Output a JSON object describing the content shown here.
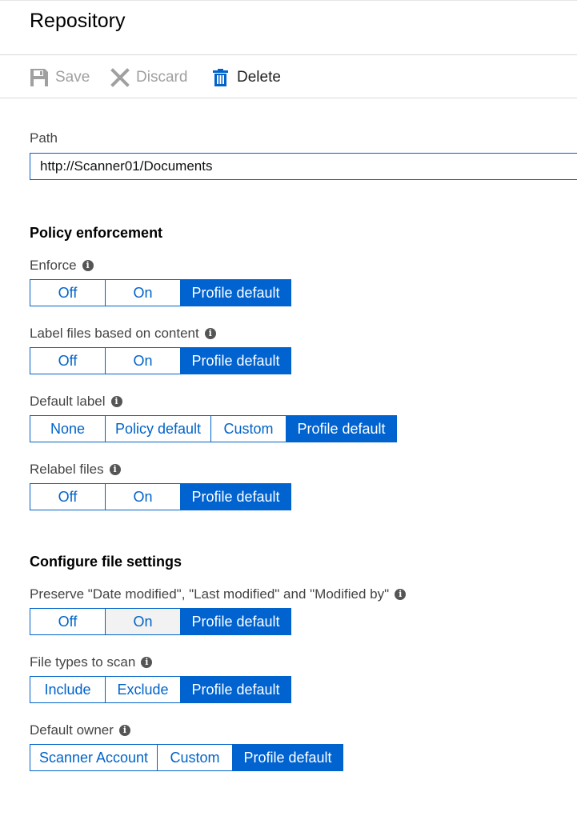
{
  "title": "Repository",
  "toolbar": {
    "save_label": "Save",
    "discard_label": "Discard",
    "delete_label": "Delete"
  },
  "path": {
    "label": "Path",
    "value": "http://Scanner01/Documents"
  },
  "policy_section": {
    "heading": "Policy enforcement",
    "enforce": {
      "label": "Enforce",
      "options": [
        "Off",
        "On",
        "Profile default"
      ],
      "selected": "Profile default"
    },
    "label_files": {
      "label": "Label files based on content",
      "options": [
        "Off",
        "On",
        "Profile default"
      ],
      "selected": "Profile default"
    },
    "default_label": {
      "label": "Default label",
      "options": [
        "None",
        "Policy default",
        "Custom",
        "Profile default"
      ],
      "selected": "Profile default"
    },
    "relabel": {
      "label": "Relabel files",
      "options": [
        "Off",
        "On",
        "Profile default"
      ],
      "selected": "Profile default"
    }
  },
  "file_section": {
    "heading": "Configure file settings",
    "preserve": {
      "label": "Preserve \"Date modified\", \"Last modified\" and \"Modified by\"",
      "options": [
        "Off",
        "On",
        "Profile default"
      ],
      "selected": "Profile default"
    },
    "file_types": {
      "label": "File types to scan",
      "options": [
        "Include",
        "Exclude",
        "Profile default"
      ],
      "selected": "Profile default"
    },
    "default_owner": {
      "label": "Default owner",
      "options": [
        "Scanner Account",
        "Custom",
        "Profile default"
      ],
      "selected": "Profile default"
    }
  },
  "colors": {
    "accent": "#0063d0",
    "border": "#0063c9",
    "disabled_text": "#a0a0a0"
  }
}
